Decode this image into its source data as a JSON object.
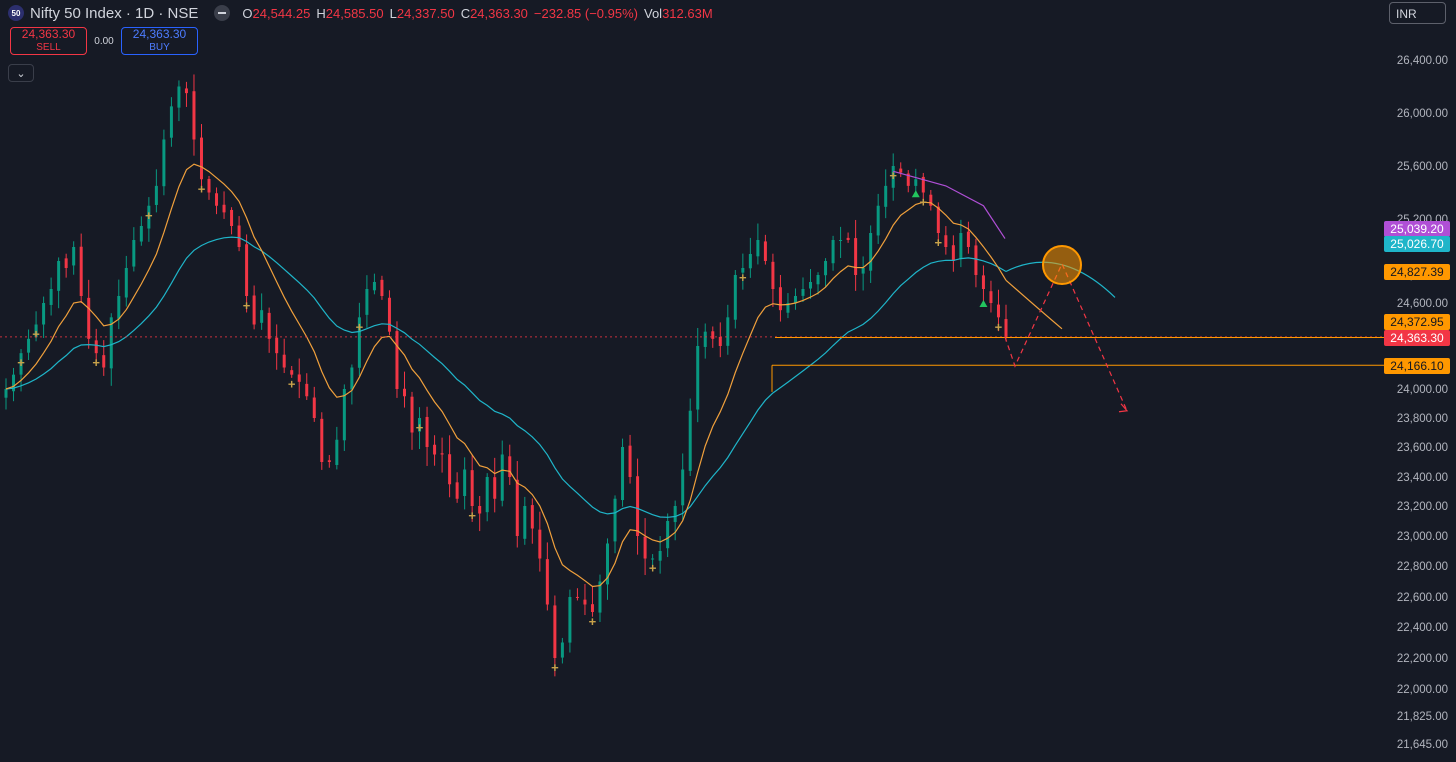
{
  "header": {
    "logo_text": "50",
    "title": "Nifty 50 Index · 1D · NSE",
    "open_label": "O",
    "open": "24,544.25",
    "high_label": "H",
    "high": "24,585.50",
    "low_label": "L",
    "low": "24,337.50",
    "close_label": "C",
    "close": "24,363.30",
    "change": "−232.85 (−0.95%)",
    "vol_label": "Vol",
    "volume": "312.63M"
  },
  "trade": {
    "sell_price": "24,363.30",
    "sell_label": "SELL",
    "spread": "0.00",
    "buy_price": "24,363.30",
    "buy_label": "BUY"
  },
  "collapse_icon": "chevron-down-icon",
  "currency": "INR",
  "colors": {
    "bull": "#089981",
    "bear": "#f23645",
    "ema_fast": "#f0a03c",
    "ema_slow": "#1fb5c9",
    "purple": "#b04fd6",
    "background": "#161a25"
  },
  "chart_data": {
    "type": "candlestick",
    "title": "Nifty 50 Index · 1D · NSE",
    "y_ticks": [
      "26,400.00",
      "26,000.00",
      "25,600.00",
      "25,200.00",
      "24,800.00",
      "24,600.00",
      "24,000.00",
      "23,800.00",
      "23,600.00",
      "23,400.00",
      "23,200.00",
      "23,000.00",
      "22,800.00",
      "22,600.00",
      "22,400.00",
      "22,200.00",
      "22,000.00",
      "21,825.00",
      "21,645.00"
    ],
    "y_tick_values": [
      26400,
      26000,
      25600,
      25200,
      24800,
      24600,
      24000,
      23800,
      23600,
      23400,
      23200,
      23000,
      22800,
      22600,
      22400,
      22200,
      22000,
      21825,
      21645
    ],
    "close_path": [
      24000,
      24100,
      24250,
      24350,
      24450,
      24600,
      24700,
      24900,
      24850,
      25000,
      24650,
      24350,
      24250,
      24150,
      24500,
      24650,
      24850,
      25050,
      25150,
      25300,
      25450,
      25800,
      26050,
      26200,
      26150,
      25800,
      25500,
      25400,
      25300,
      25250,
      25150,
      25000,
      24650,
      24450,
      24550,
      24350,
      24250,
      24150,
      24100,
      24050,
      23950,
      23800,
      23500,
      23500,
      23650,
      24000,
      24150,
      24500,
      24700,
      24750,
      24650,
      24400,
      24000,
      23950,
      23700,
      23800,
      23600,
      23550,
      23550,
      23350,
      23250,
      23450,
      23200,
      23150,
      23400,
      23250,
      23550,
      23400,
      23000,
      23200,
      23050,
      22850,
      22550,
      22200,
      22300,
      22600,
      22600,
      22550,
      22500,
      22700,
      22950,
      23250,
      23600,
      23400,
      23000,
      22850,
      22850,
      22900,
      23100,
      23200,
      23450,
      23850,
      24300,
      24400,
      24350,
      24300,
      24500,
      24800,
      24850,
      24950,
      25050,
      24900,
      24700,
      24550,
      24600,
      24650,
      24700,
      24750,
      24800,
      24900,
      25050,
      25050,
      25050,
      24800,
      24850,
      25100,
      25300,
      25450,
      25600,
      25550,
      25450,
      25500,
      25400,
      25300,
      25100,
      25000,
      24900,
      25100,
      25000,
      24800,
      24700,
      24600,
      24500,
      24363.3
    ],
    "ema_fast_tail": 24372.95,
    "ema_slow_tail": 25026.7,
    "markers": {
      "plus": [
        2,
        4,
        12,
        19,
        26,
        32,
        38,
        47,
        55,
        62,
        73,
        78,
        86,
        98,
        118,
        122,
        124,
        132
      ],
      "triangle_up": [
        121,
        130
      ]
    },
    "price_tags": [
      {
        "value": 25039.2,
        "label": "25,039.20",
        "color": "#b04fd6"
      },
      {
        "value": 25026.7,
        "label": "25,026.70",
        "color": "#1fb5c9"
      },
      {
        "value": 24827.39,
        "label": "24,827.39",
        "color": "#ff9800"
      },
      {
        "value": 24372.95,
        "label": "24,372.95",
        "color": "#ff9800"
      },
      {
        "value": 24363.3,
        "label": "24,363.30",
        "color": "#f23645"
      },
      {
        "value": 24166.1,
        "label": "24,166.10",
        "color": "#ff9800"
      }
    ],
    "horizontal_levels": [
      24363.3,
      24166.1
    ],
    "projection": {
      "points": [
        24363.3,
        24160,
        24880,
        23850
      ]
    },
    "grid": false
  }
}
